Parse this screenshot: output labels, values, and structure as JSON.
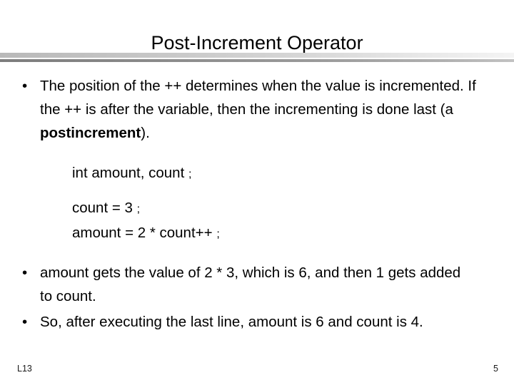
{
  "slide": {
    "title": "Post-Increment Operator",
    "bullet_marker": "•",
    "bullets": [
      {
        "id": "bullet-position-of-plusplus",
        "text_before_bold": "The position of the ++ determines when the value is incremented.  If the ++ is after the variable, then the incrementing is done last (a ",
        "bold_text": "postincrement",
        "text_after_bold": ")."
      },
      {
        "id": "bullet-amount-gets-value",
        "text": "amount gets the value of 2 * 3, which is 6, and then 1 gets added to count."
      },
      {
        "id": "bullet-after-executing",
        "text": "So, after executing the last line, amount is 6 and count is 4."
      }
    ],
    "code": {
      "declaration": "int amount, count ",
      "declaration_semicolon": ";",
      "assignment_count": "count = 3 ",
      "assignment_count_semicolon": ";",
      "assignment_amount": "amount = 2 * count++ ",
      "assignment_amount_semicolon": ";"
    },
    "footer": {
      "left_label": "L13",
      "page_number": "5"
    },
    "colors": {
      "background": "#ffffff",
      "text": "#000000",
      "divider_light": "#c6c6c6",
      "divider_dark": "#8a8a8a",
      "footer_text": "#1a1a1a"
    }
  }
}
